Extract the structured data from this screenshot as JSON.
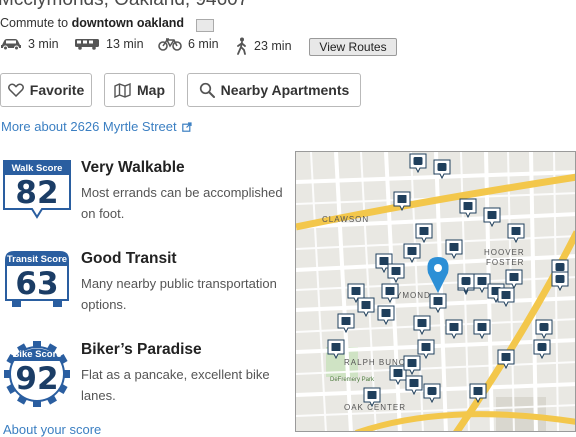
{
  "address": "Mcclymonds, Oakland, 94607",
  "commute": {
    "prefix": "Commute to",
    "destination": "downtown oakland",
    "modes": [
      {
        "icon": "car-icon",
        "time": "3 min"
      },
      {
        "icon": "bus-icon",
        "time": "13 min"
      },
      {
        "icon": "bike-icon",
        "time": "6 min"
      },
      {
        "icon": "walk-icon",
        "time": "23 min"
      }
    ],
    "view_routes_label": "View Routes"
  },
  "actions": {
    "favorite_label": "Favorite",
    "map_label": "Map",
    "nearby_label": "Nearby Apartments"
  },
  "more_link": "More about 2626 Myrtle Street",
  "scores": [
    {
      "badge_label": "Walk Score",
      "value": "82",
      "title": "Very Walkable",
      "description": "Most errands can be accomplished on foot."
    },
    {
      "badge_label": "Transit Score",
      "value": "63",
      "title": "Good Transit",
      "description": "Many nearby public transportation options."
    },
    {
      "badge_label": "Bike Score",
      "value": "92",
      "title": "Biker’s Paradise",
      "description": "Flat as a pancake, excellent bike lanes."
    }
  ],
  "about_link": "About your score",
  "map": {
    "labels": {
      "clawson": "CLAWSON",
      "hoover": "HOOVER",
      "foster": "FOSTER",
      "ymond": "YMOND",
      "ralph": "RALPH BUNCHE",
      "oakcenter": "OAK CENTER",
      "defremery": "DeFremery Park"
    }
  },
  "colors": {
    "badge_blue": "#2a5ea0",
    "link": "#3b7fc2",
    "pin": "#2c8fd6",
    "map_icon": "#1f3f5c",
    "highway": "#f3c74b"
  }
}
